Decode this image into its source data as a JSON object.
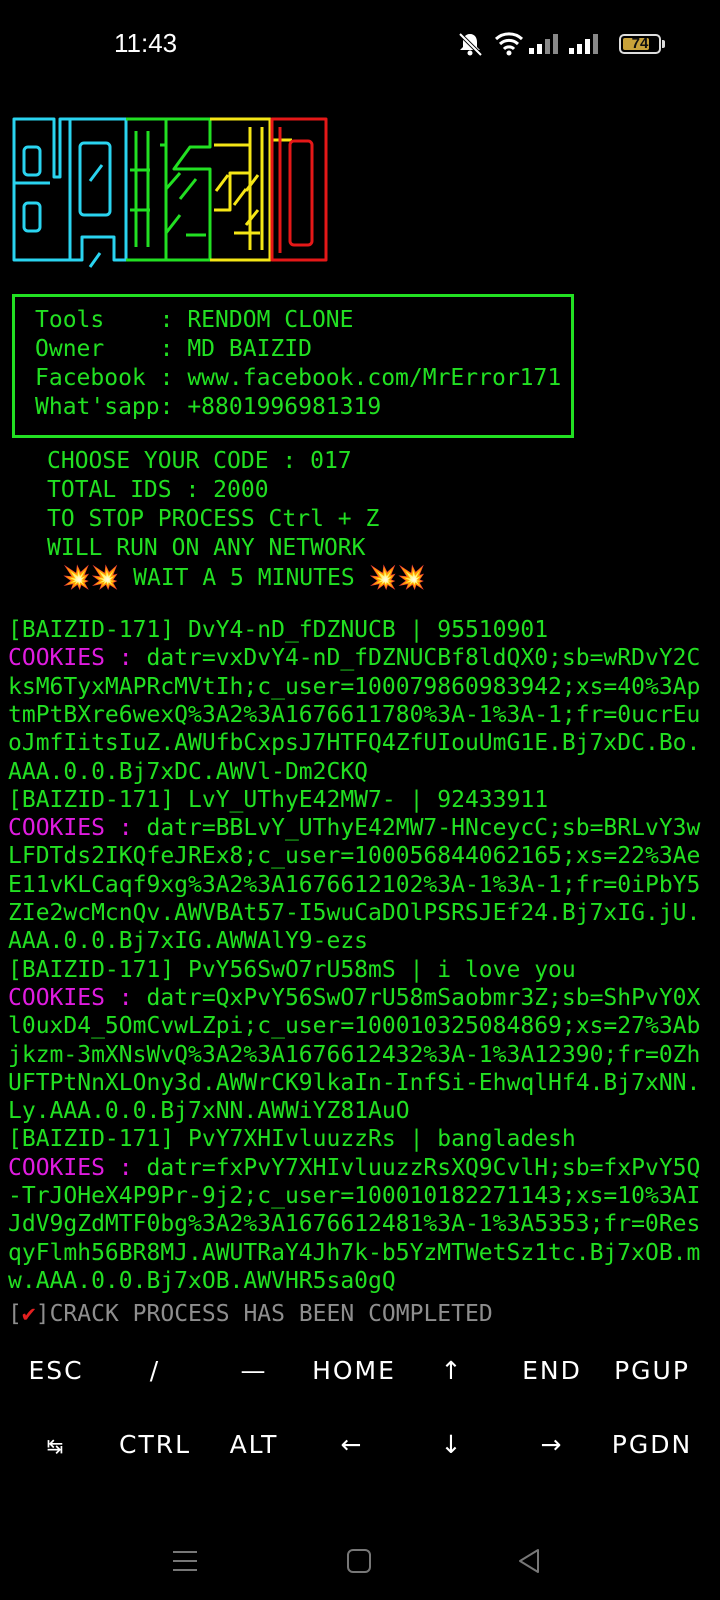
{
  "status_bar": {
    "time": "11:43",
    "battery": "74",
    "icons": [
      "mute-icon",
      "wifi-icon",
      "signal-icon",
      "signal-icon"
    ]
  },
  "banner": {
    "lines": [
      {
        "key": "Tools    ",
        "value": "RENDOM CLONE"
      },
      {
        "key": "Owner    ",
        "value": "MD BAIZID"
      },
      {
        "key": "Facebook ",
        "value": "www.facebook.com/MrError171"
      },
      {
        "key": "What'sapp",
        "value": "+8801996981319"
      }
    ]
  },
  "run_info": {
    "choose_code": "CHOOSE YOUR CODE : 017",
    "total_ids": "TOTAL IDS : 2000",
    "stop_process": "TO STOP PROCESS Ctrl + Z",
    "network": "WILL RUN ON ANY NETWORK",
    "wait": "💥💥 WAIT A 5 MINUTES 💥💥"
  },
  "results": [
    {
      "header": "[BAIZID-171] DvY4-nD_fDZNUCB | 95510901",
      "cookie_label": "COOKIES :",
      "cookie_lines": [
        " datr=vxDvY4-nD_fDZNUCBf8ldQX0;sb=wRDvY2C",
        "ksM6TyxMAPRcMVtIh;c_user=100079860983942;xs=40%3Ap",
        "tmPtBXre6wexQ%3A2%3A1676611780%3A-1%3A-1;fr=0ucrEu",
        "oJmfIitsIuZ.AWUfbCxpsJ7HTFQ4ZfUIouUmG1E.Bj7xDC.Bo.",
        "AAA.0.0.Bj7xDC.AWVl-Dm2CKQ"
      ]
    },
    {
      "header": "[BAIZID-171] LvY_UThyE42MW7- | 92433911",
      "cookie_label": "COOKIES :",
      "cookie_lines": [
        " datr=BBLvY_UThyE42MW7-HNceycC;sb=BRLvY3w",
        "LFDTds2IKQfeJREx8;c_user=100056844062165;xs=22%3Ae",
        "E11vKLCaqf9xg%3A2%3A1676612102%3A-1%3A-1;fr=0iPbY5",
        "ZIe2wcMcnQv.AWVBAt57-I5wuCaDOlPSRSJEf24.Bj7xIG.jU.",
        "AAA.0.0.Bj7xIG.AWWAlY9-ezs"
      ]
    },
    {
      "header": "[BAIZID-171] PvY56SwO7rU58mS | i love you",
      "cookie_label": "COOKIES :",
      "cookie_lines": [
        " datr=QxPvY56SwO7rU58mSaobmr3Z;sb=ShPvY0X",
        "l0uxD4_5OmCvwLZpi;c_user=100010325084869;xs=27%3Ab",
        "jkzm-3mXNsWvQ%3A2%3A1676612432%3A-1%3A12390;fr=0Zh",
        "UFTPtNnXLOny3d.AWWrCK9lkaIn-InfSi-EhwqlHf4.Bj7xNN.",
        "Ly.AAA.0.0.Bj7xNN.AWWiYZ81AuO"
      ]
    },
    {
      "header": "[BAIZID-171] PvY7XHIvluuzzRs | bangladesh",
      "cookie_label": "COOKIES :",
      "cookie_lines": [
        " datr=fxPvY7XHIvluuzzRsXQ9CvlH;sb=fxPvY5Q",
        "-TrJOHeX4P9Pr-9j2;c_user=100010182271143;xs=10%3AI",
        "JdV9gZdMTF0bg%3A2%3A1676612481%3A-1%3A5353;fr=0Res",
        "qyFlmh56BR8MJ.AWUTRaY4Jh7k-b5YzMTWetSz1tc.Bj7xOB.m",
        "w.AAA.0.0.Bj7xOB.AWVHR5sa0gQ"
      ]
    }
  ],
  "completion": {
    "bracket_open": "[",
    "check": "✔",
    "bracket_close": "]",
    "text": "CRACK PROCESS HAS BEEN COMPLETED"
  },
  "extra_keys": {
    "row1": [
      "ESC",
      "/",
      "—",
      "HOME",
      "↑",
      "END",
      "PGUP"
    ],
    "row2": [
      "↹",
      "CTRL",
      "ALT",
      "←",
      "↓",
      "→",
      "PGDN"
    ]
  },
  "colors": {
    "green": "#22e022",
    "magenta": "#e01ce0",
    "logo_cyan": "#2ad4f0",
    "logo_green": "#22e022",
    "logo_yellow": "#f5e616",
    "logo_red": "#e51818"
  }
}
